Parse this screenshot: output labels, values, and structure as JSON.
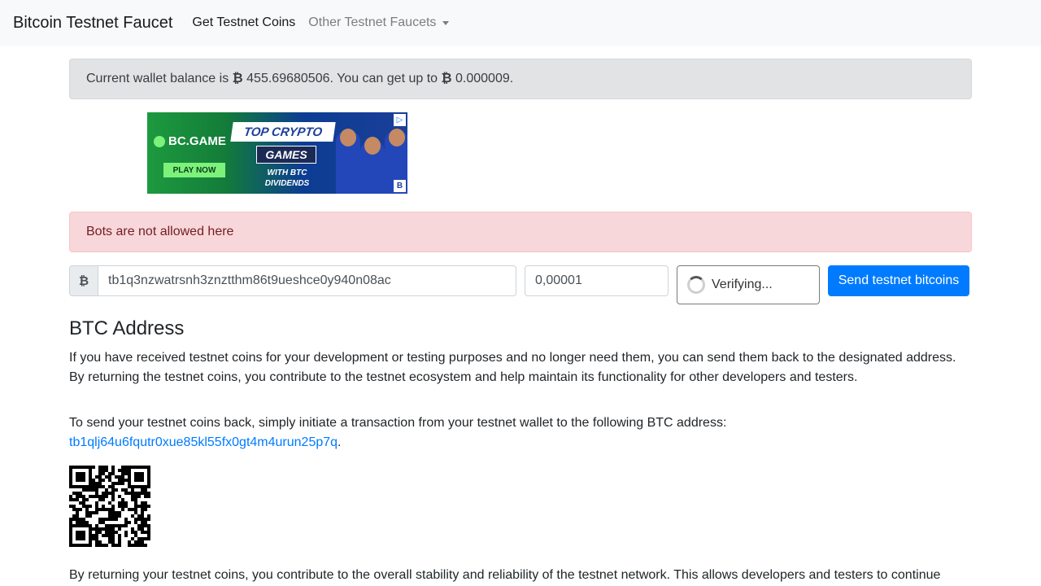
{
  "nav": {
    "brand": "Bitcoin Testnet Faucet",
    "links": [
      {
        "label": "Get Testnet Coins"
      },
      {
        "label": "Other Testnet Faucets"
      }
    ]
  },
  "balance_alert": {
    "prefix": "Current wallet balance is ",
    "symbol": "₿",
    "balance": "455.69680506",
    "middle": ". You can get up to ",
    "max_amount": "0.000009",
    "suffix": "."
  },
  "ad": {
    "logo": "BC.GAME",
    "headline": "TOP CRYPTO",
    "games": "GAMES",
    "cta": "PLAY NOW",
    "subline": "WITH BTC DIVIDENDS",
    "badge": "B"
  },
  "error_alert": {
    "message": "Bots are not allowed here"
  },
  "form": {
    "currency_symbol": "₿",
    "address_value": "tb1q3nzwatrsnh3znztthm86t9ueshce0y940n08ac",
    "amount_value": "0,00001",
    "captcha_status": "Verifying...",
    "submit_label": "Send testnet bitcoins"
  },
  "section": {
    "title": "BTC Address",
    "para1": "If you have received testnet coins for your development or testing purposes and no longer need them, you can send them back to the designated address. By returning the testnet coins, you contribute to the testnet ecosystem and help maintain its functionality for other developers and testers.",
    "para2": "To send your testnet coins back, simply initiate a transaction from your testnet wallet to the following BTC address:",
    "return_address": "tb1qlj64u6fqutr0xue85kl55fx0gt4m4urun25p7q",
    "para3": "By returning your testnet coins, you contribute to the overall stability and reliability of the testnet network. This allows developers and testers to continue"
  },
  "colors": {
    "primary": "#007bff",
    "navbar_bg": "#f8f9fa",
    "balance_alert_bg": "#e2e3e5",
    "danger_alert_bg": "#f8d7da",
    "danger_alert_text": "#721c24"
  },
  "icons": {
    "currency_icon": "bitcoin-sign",
    "captcha_icon": "spinner",
    "qr": "qr-code"
  }
}
